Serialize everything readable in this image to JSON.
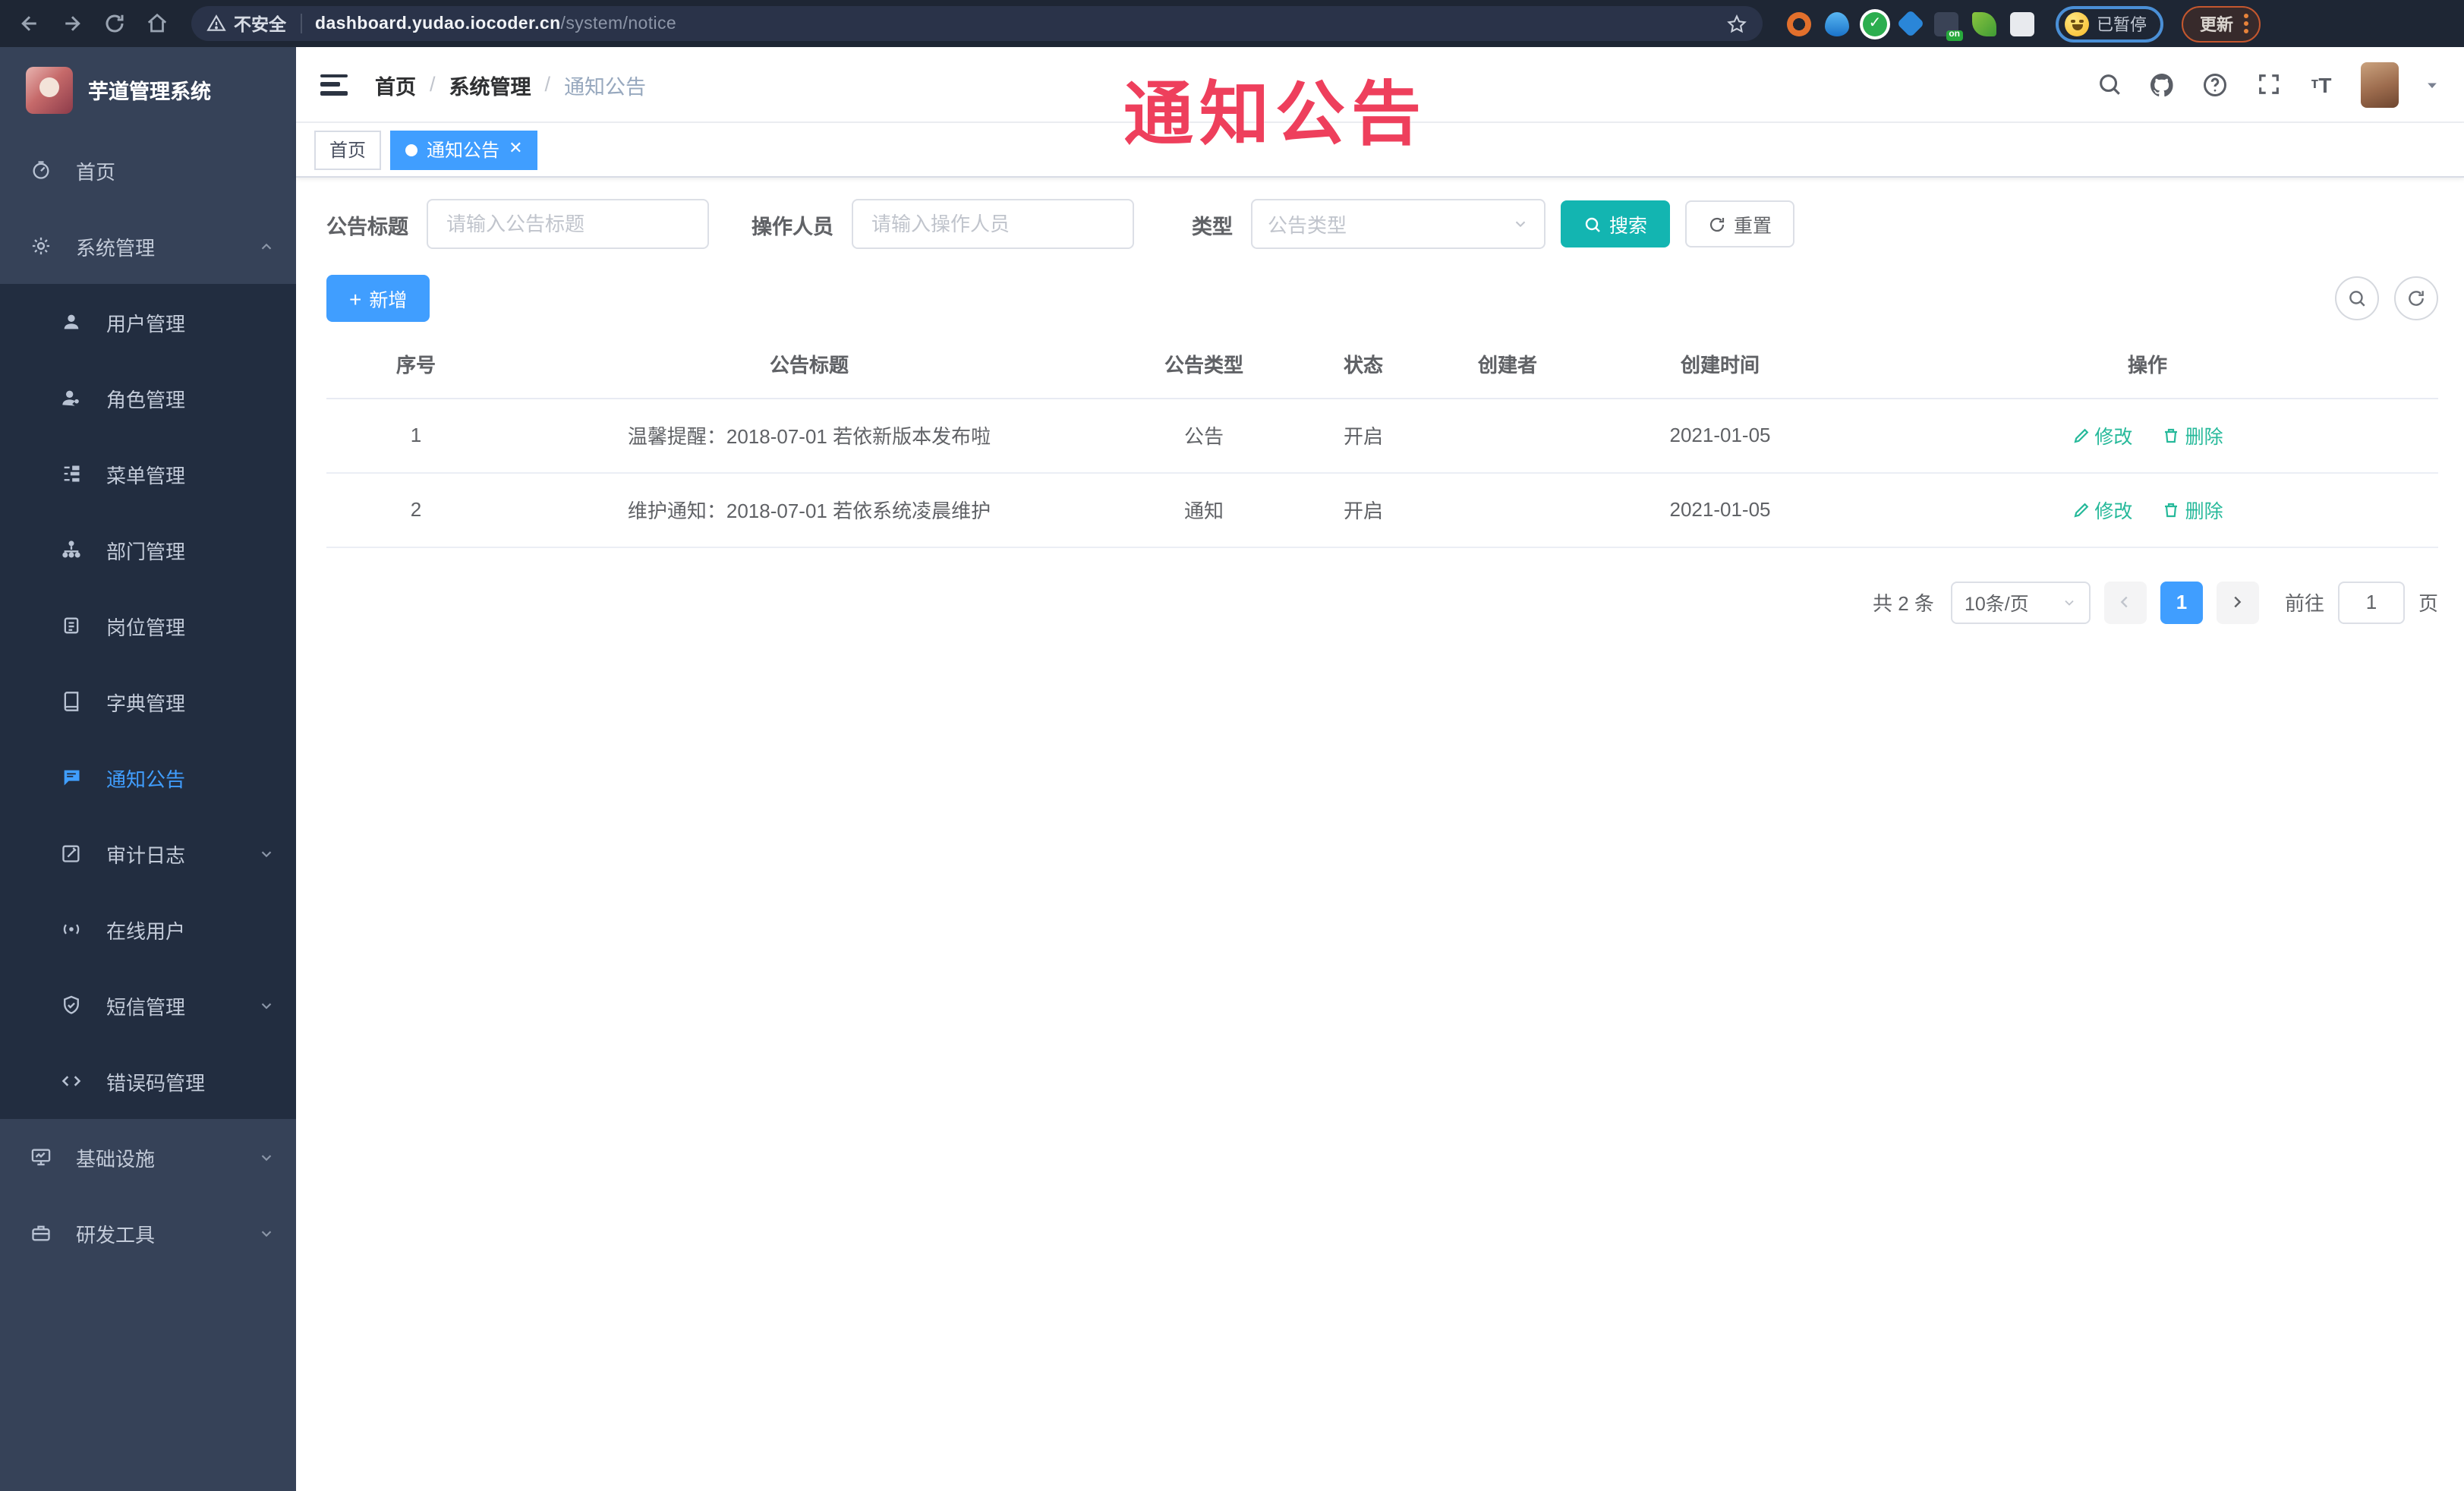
{
  "browser": {
    "security_warning": "不安全",
    "url_host": "dashboard.yudao.iocoder.cn",
    "url_path": "/system/notice",
    "extension_on_badge": "on",
    "paused_badge": "已暂停",
    "update_button": "更新"
  },
  "annotation": {
    "text": "通知公告"
  },
  "sidebar": {
    "app_title": "芋道管理系统",
    "items": [
      {
        "label": "首页"
      },
      {
        "label": "系统管理"
      },
      {
        "label": "用户管理"
      },
      {
        "label": "角色管理"
      },
      {
        "label": "菜单管理"
      },
      {
        "label": "部门管理"
      },
      {
        "label": "岗位管理"
      },
      {
        "label": "字典管理"
      },
      {
        "label": "通知公告"
      },
      {
        "label": "审计日志"
      },
      {
        "label": "在线用户"
      },
      {
        "label": "短信管理"
      },
      {
        "label": "错误码管理"
      },
      {
        "label": "基础设施"
      },
      {
        "label": "研发工具"
      }
    ]
  },
  "header": {
    "breadcrumb": [
      "首页",
      "系统管理",
      "通知公告"
    ]
  },
  "tabs": [
    {
      "label": "首页"
    },
    {
      "label": "通知公告"
    }
  ],
  "filters": {
    "title_label": "公告标题",
    "title_placeholder": "请输入公告标题",
    "operator_label": "操作人员",
    "operator_placeholder": "请输入操作人员",
    "type_label": "类型",
    "type_placeholder": "公告类型",
    "search_label": "搜索",
    "reset_label": "重置"
  },
  "toolbar": {
    "add_label": "新增"
  },
  "table": {
    "headers": [
      "序号",
      "公告标题",
      "公告类型",
      "状态",
      "创建者",
      "创建时间",
      "操作"
    ],
    "rows": [
      {
        "no": "1",
        "title": "温馨提醒：2018-07-01 若依新版本发布啦",
        "type": "公告",
        "status": "开启",
        "creator": "",
        "created_at": "2021-01-05"
      },
      {
        "no": "2",
        "title": "维护通知：2018-07-01 若依系统凌晨维护",
        "type": "通知",
        "status": "开启",
        "creator": "",
        "created_at": "2021-01-05"
      }
    ],
    "actions": {
      "edit": "修改",
      "delete": "删除"
    }
  },
  "pagination": {
    "total_text": "共 2 条",
    "page_size": "10条/页",
    "current_page": "1",
    "goto_label": "前往",
    "goto_value": "1",
    "goto_suffix": "页"
  },
  "colors": {
    "primary_blue": "#409eff",
    "search_teal": "#13b5b1",
    "link_teal": "#26b99a",
    "annotation_red": "#ee3f5c",
    "sidebar_bg": "#364258",
    "submenu_bg": "#222d40"
  }
}
